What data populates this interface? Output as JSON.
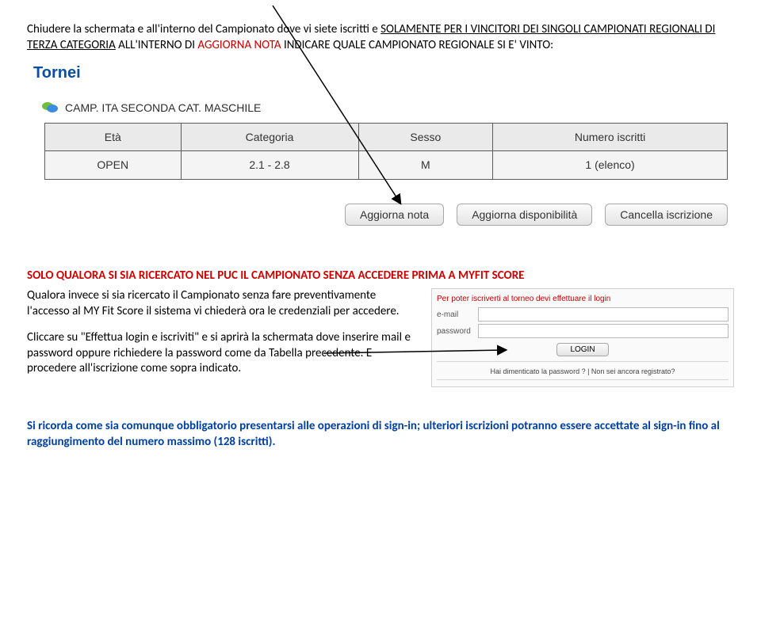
{
  "intro": {
    "line1_a": "Chiudere la schermata e all'interno del Campionato dove vi siete iscritti e ",
    "line1_b": "SOLAMENTE PER I VINCITORI DEI SINGOLI CAMPIONATI REGIONALI DI TERZA CATEGORIA",
    "line1_c": " ALL'INTERNO DI ",
    "line1_d": "AGGIORNA NOTA",
    "line1_e": " INDICARE QUALE CAMPIONATO REGIONALE SI E' VINTO:"
  },
  "tornei": {
    "title": "Tornei",
    "camp_name": "CAMP. ITA SECONDA CAT. MASCHILE",
    "headers": {
      "eta": "Età",
      "categoria": "Categoria",
      "sesso": "Sesso",
      "iscritti": "Numero iscritti"
    },
    "row": {
      "eta": "OPEN",
      "categoria": "2.1 - 2.8",
      "sesso": "M",
      "iscritti": "1 (elenco)"
    },
    "buttons": {
      "aggiorna_nota": "Aggiorna nota",
      "aggiorna_disp": "Aggiorna disponibilità",
      "cancella": "Cancella iscrizione"
    }
  },
  "middle": {
    "red_heading": "SOLO QUALORA SI SIA RICERCATO NEL PUC IL CAMPIONATO SENZA ACCEDERE PRIMA A MYFIT SCORE",
    "p1": "Qualora invece si sia ricercato il Campionato senza fare preventivamente l'accesso al MY Fit Score il sistema vi chiederà ora le credenziali per accedere.",
    "p2": "Cliccare su \"Effettua login e iscriviti\" e si aprirà la schermata dove inserire mail e password oppure richiedere la password come da Tabella precedente. E procedere all'iscrizione come sopra indicato."
  },
  "login": {
    "msg": "Per poter iscriverti al torneo devi effettuare il login",
    "email_lbl": "e-mail",
    "pwd_lbl": "password",
    "btn": "LOGIN",
    "links": "Hai dimenticato la password ?  |  Non sei ancora registrato?"
  },
  "footer": {
    "line1": "Si ricorda come sia comunque obbligatorio presentarsi alle operazioni di sign-in; ulteriori iscrizioni potranno essere accettate al sign-in fino al raggiungimento del numero massimo (128 iscritti)."
  }
}
